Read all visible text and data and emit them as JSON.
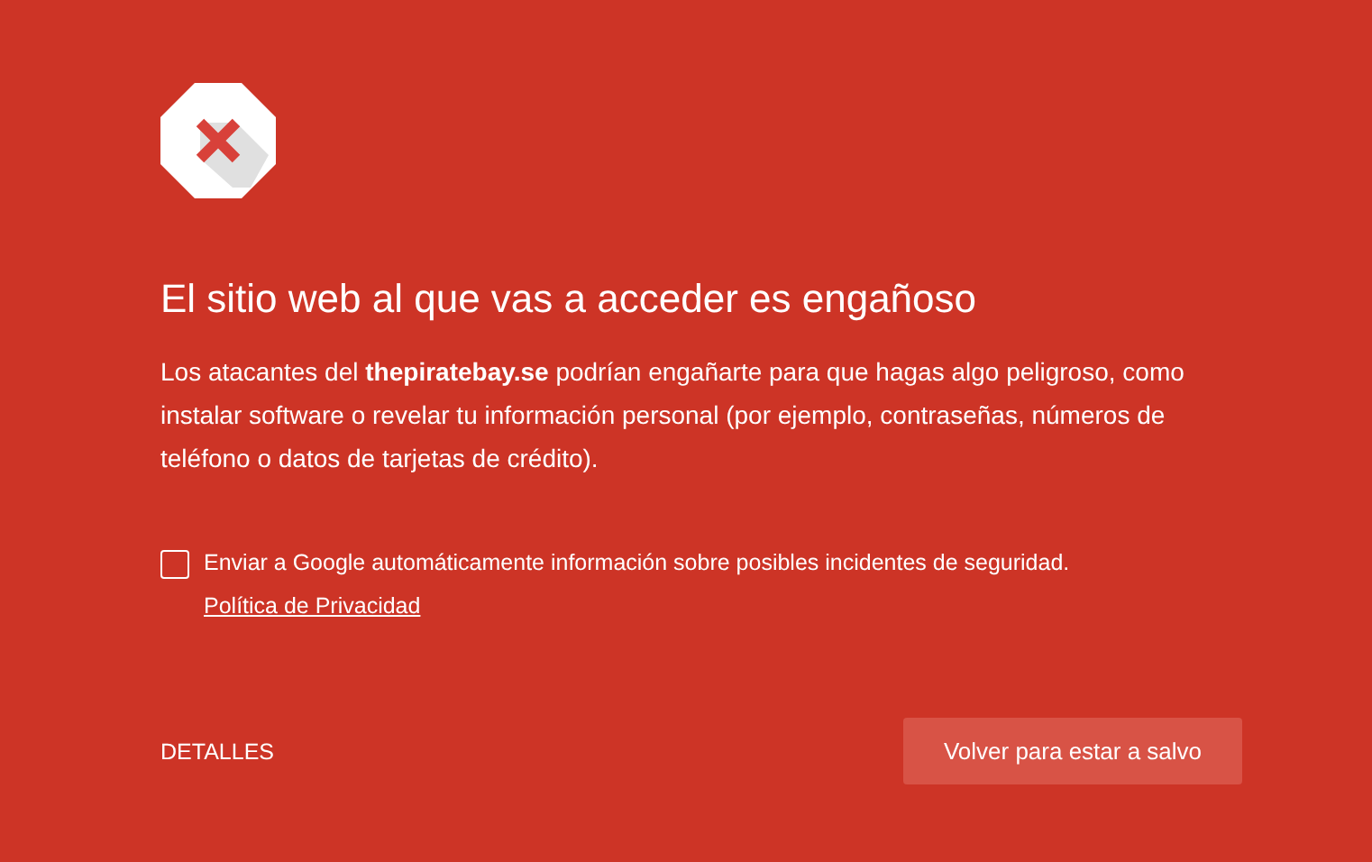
{
  "heading": "El sitio web al que vas a acceder es engañoso",
  "message": "Los atacantes del **thepiratebay.se** podrían engañarte para que hagas algo peligroso, como instalar software o revelar tu información personal (por ejemplo, contraseñas, números de teléfono o datos de tarjetas de crédito).",
  "report": {
    "label": "Enviar a Google automáticamente información sobre posibles incidentes de seguridad.",
    "link": "Política de Privacidad",
    "checked": false
  },
  "details_link": "DETALLES",
  "primary_button": "Volver para estar a salvo"
}
